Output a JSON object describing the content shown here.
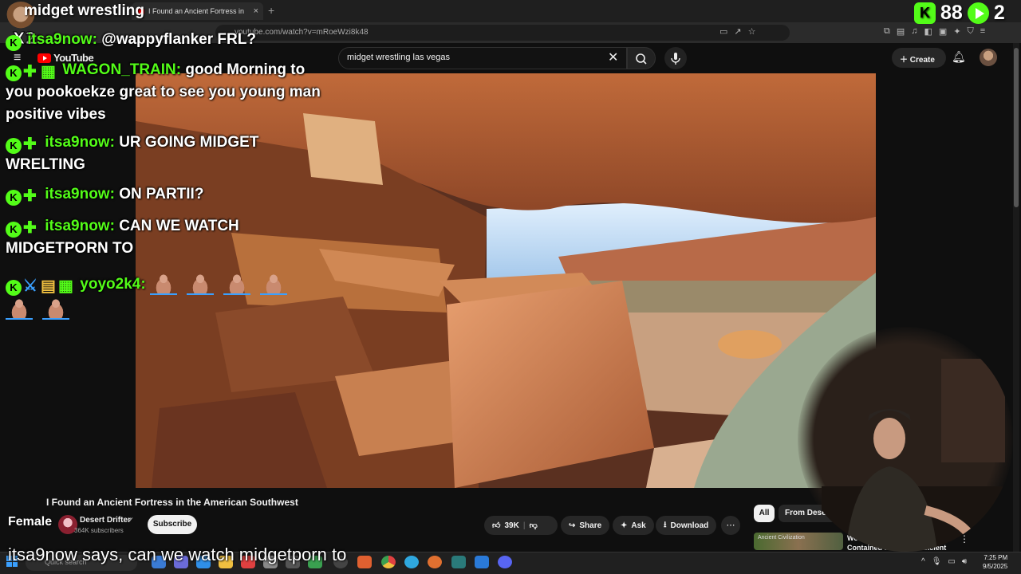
{
  "overlay": {
    "title": "midget wrestling",
    "multiplier": "X2",
    "counter_value": "88",
    "viewer_value": "2",
    "female_label": "Female",
    "tts_caption": "itsa9now says, can we watch midgetporn to"
  },
  "chat": {
    "messages": [
      {
        "user": "itsa9now:",
        "text": "@wappyflanker FRL?"
      },
      {
        "user": "WAGON_TRAIN:",
        "text": "good Morning to you pookoekze great to see you young man positive vibes"
      },
      {
        "user": "itsa9now:",
        "text": "UR GOING MIDGET WRELTING"
      },
      {
        "user": "itsa9now:",
        "text": "ON PARTII?"
      },
      {
        "user": "itsa9now:",
        "text": "CAN WE WATCH MIDGETPORN TO"
      },
      {
        "user": "yoyo2k4:",
        "text": ""
      }
    ]
  },
  "browser": {
    "tab_title": "I Found an Ancient Fortress in",
    "url": "youtube.com/watch?v=mRoeWzi8k48"
  },
  "youtube": {
    "logo": "YouTube",
    "search_value": "midget wrestling las vegas",
    "create_label": "Create",
    "video_title": "I Found an Ancient Fortress in the American Southwest",
    "channel_name": "Desert Drifter",
    "subscribers": "364K subscribers",
    "subscribe_label": "Subscribe",
    "likes": "39K",
    "share_label": "Share",
    "ask_label": "Ask",
    "download_label": "Download",
    "chip_all": "All",
    "chip_from": "From Desert Drifter",
    "rec_title": "We Found a Jungle that Contained a Massive Ancient",
    "rec_thumb_text": "Ancient Civilization"
  },
  "taskbar": {
    "search_placeholder": "Quick search",
    "time": "7:25 PM",
    "date": "9/5/2025"
  },
  "colors": {
    "kick_green": "#53fc18",
    "youtube_red": "#ff0000",
    "background": "#0f0f0f"
  }
}
